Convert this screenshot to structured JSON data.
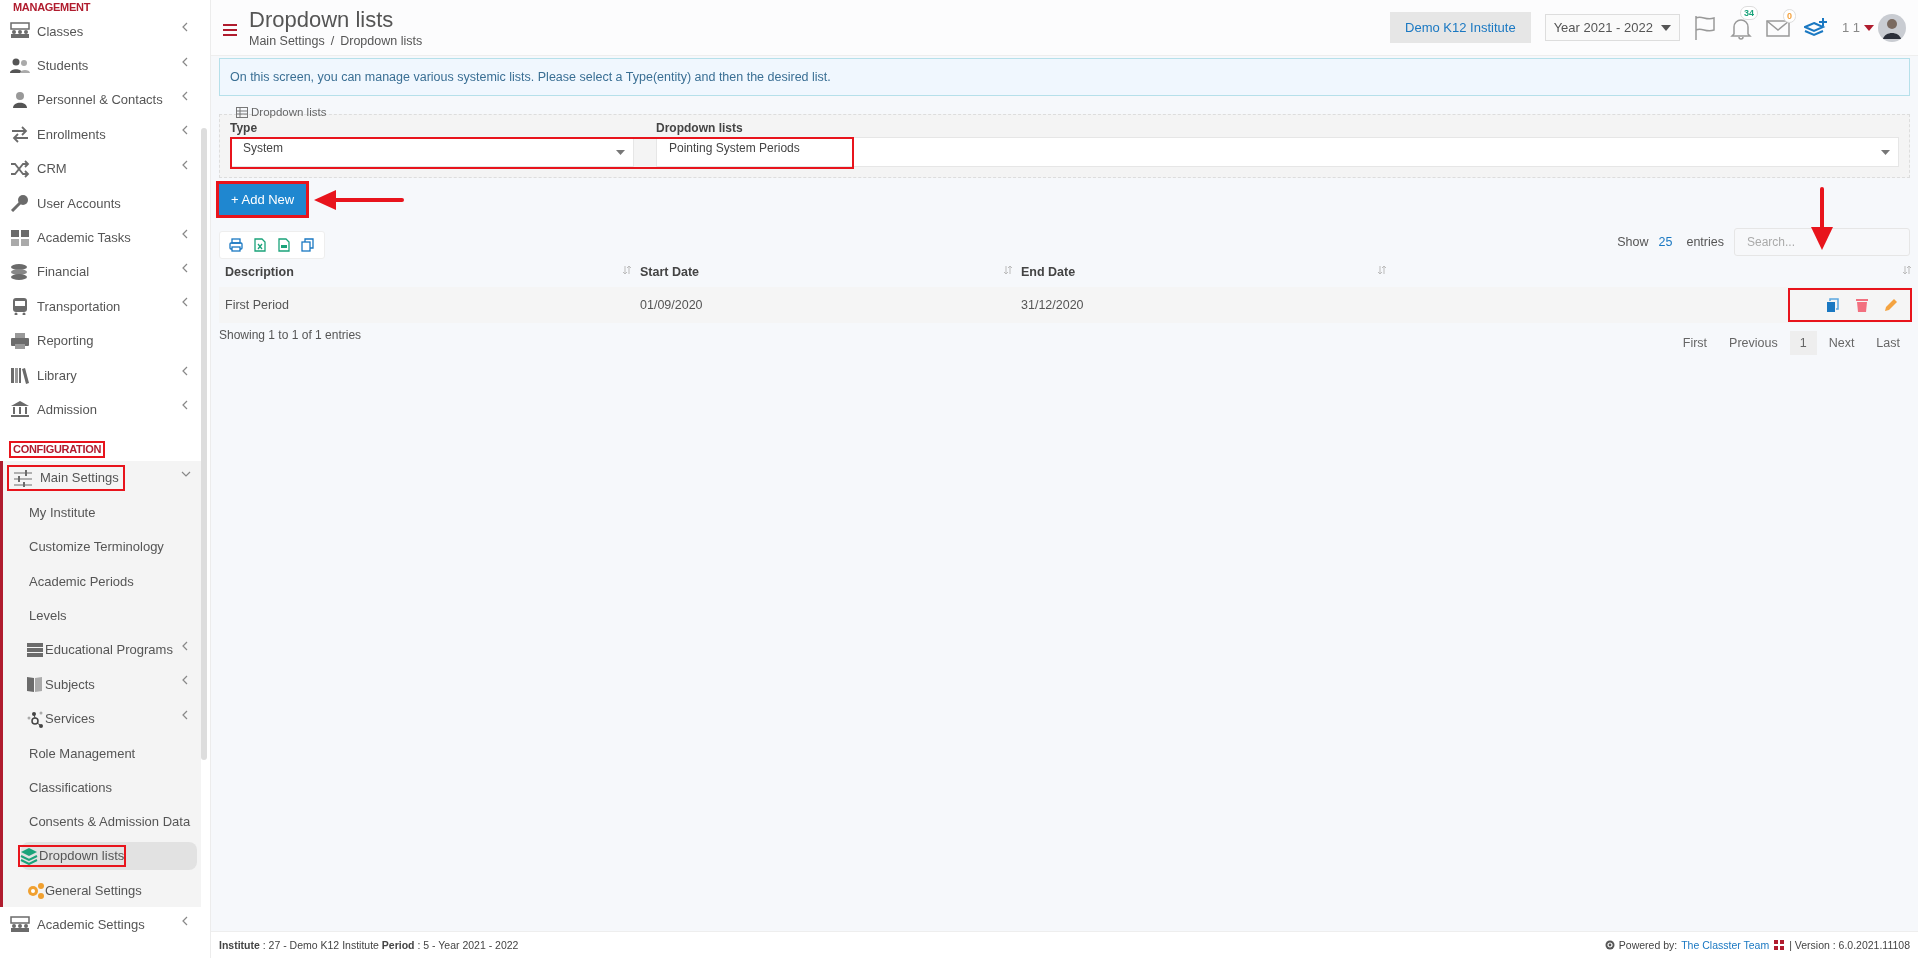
{
  "sidebar": {
    "sections": [
      {
        "title": "MANAGEMENT",
        "highlighted": false,
        "items": [
          {
            "label": "Classes",
            "has_children": true,
            "expanded": false,
            "highlighted": false
          },
          {
            "label": "Students",
            "has_children": true,
            "expanded": false,
            "highlighted": false
          },
          {
            "label": "Personnel & Contacts",
            "has_children": true,
            "expanded": false,
            "highlighted": false
          },
          {
            "label": "Enrollments",
            "has_children": true,
            "expanded": false,
            "highlighted": false
          },
          {
            "label": "CRM",
            "has_children": true,
            "expanded": false,
            "highlighted": false
          },
          {
            "label": "User Accounts",
            "has_children": false,
            "highlighted": false
          },
          {
            "label": "Academic Tasks",
            "has_children": true,
            "expanded": false,
            "highlighted": false
          },
          {
            "label": "Financial",
            "has_children": true,
            "expanded": false,
            "highlighted": false
          },
          {
            "label": "Transportation",
            "has_children": true,
            "expanded": false,
            "highlighted": false
          },
          {
            "label": "Reporting",
            "has_children": false,
            "highlighted": false
          },
          {
            "label": "Library",
            "has_children": true,
            "expanded": false,
            "highlighted": false
          },
          {
            "label": "Admission",
            "has_children": true,
            "expanded": false,
            "highlighted": false
          }
        ]
      },
      {
        "title": "CONFIGURATION",
        "highlighted": true,
        "items": [
          {
            "label": "Main Settings",
            "has_children": true,
            "expanded": true,
            "highlighted": true,
            "children": [
              {
                "label": "My Institute",
                "has_children": false,
                "selected": false,
                "highlighted": false
              },
              {
                "label": "Customize Terminology",
                "has_children": false,
                "selected": false,
                "highlighted": false
              },
              {
                "label": "Academic Periods",
                "has_children": false,
                "selected": false,
                "highlighted": false
              },
              {
                "label": "Levels",
                "has_children": false,
                "selected": false,
                "highlighted": false
              },
              {
                "label": "Educational Programs",
                "has_children": true,
                "selected": false,
                "highlighted": false
              },
              {
                "label": "Subjects",
                "has_children": true,
                "selected": false,
                "highlighted": false
              },
              {
                "label": "Services",
                "has_children": true,
                "selected": false,
                "highlighted": false
              },
              {
                "label": "Role Management",
                "has_children": false,
                "selected": false,
                "highlighted": false
              },
              {
                "label": "Classifications",
                "has_children": false,
                "selected": false,
                "highlighted": false
              },
              {
                "label": "Consents & Admission Data",
                "has_children": false,
                "selected": false,
                "highlighted": false
              },
              {
                "label": "Dropdown lists",
                "has_children": false,
                "selected": true,
                "highlighted": true
              },
              {
                "label": "General Settings",
                "has_children": false,
                "selected": false,
                "highlighted": false
              }
            ]
          },
          {
            "label": "Academic Settings",
            "has_children": true,
            "expanded": false,
            "highlighted": false
          }
        ]
      }
    ]
  },
  "header": {
    "title": "Dropdown lists",
    "breadcrumb": [
      "Main Settings",
      "Dropdown lists"
    ],
    "breadcrumb_separator": "/",
    "institute": "Demo K12 Institute",
    "year": "Year 2021 - 2022",
    "notifications": "34",
    "messages": "0",
    "user": "1 1"
  },
  "info": "On this screen, you can manage various systemic lists. Please select a Type(entity) and then the desired list.",
  "filter": {
    "legend": "Dropdown lists",
    "type_label": "Type",
    "type_value": "System",
    "list_label": "Dropdown lists",
    "list_value": "Pointing System Periods",
    "highlighted": true
  },
  "add_button": {
    "label": "+ Add New",
    "highlighted": true,
    "pointed_at": true
  },
  "table": {
    "show_label": "Show",
    "page_size": "25",
    "entries_label": "entries",
    "search_placeholder": "Search...",
    "columns": [
      "Description",
      "Start Date",
      "End Date"
    ],
    "rows": [
      {
        "cells": [
          "First Period",
          "01/09/2020",
          "31/12/2020"
        ]
      }
    ],
    "actions_highlighted": true,
    "actions_pointed_at": true,
    "summary": "Showing 1 to 1 of 1 entries",
    "pagination": [
      {
        "label": "First",
        "selected": false
      },
      {
        "label": "Previous",
        "selected": false
      },
      {
        "label": "1",
        "selected": true
      },
      {
        "label": "Next",
        "selected": false
      },
      {
        "label": "Last",
        "selected": false
      }
    ]
  },
  "footer": {
    "info": "**Institute** : 27 - Demo K12 Institute **Period** : 5 - Year 2021 - 2022",
    "powered": "Powered by:",
    "team": "The Classter Team",
    "version": "| Version : 6.0.2021.11108"
  }
}
